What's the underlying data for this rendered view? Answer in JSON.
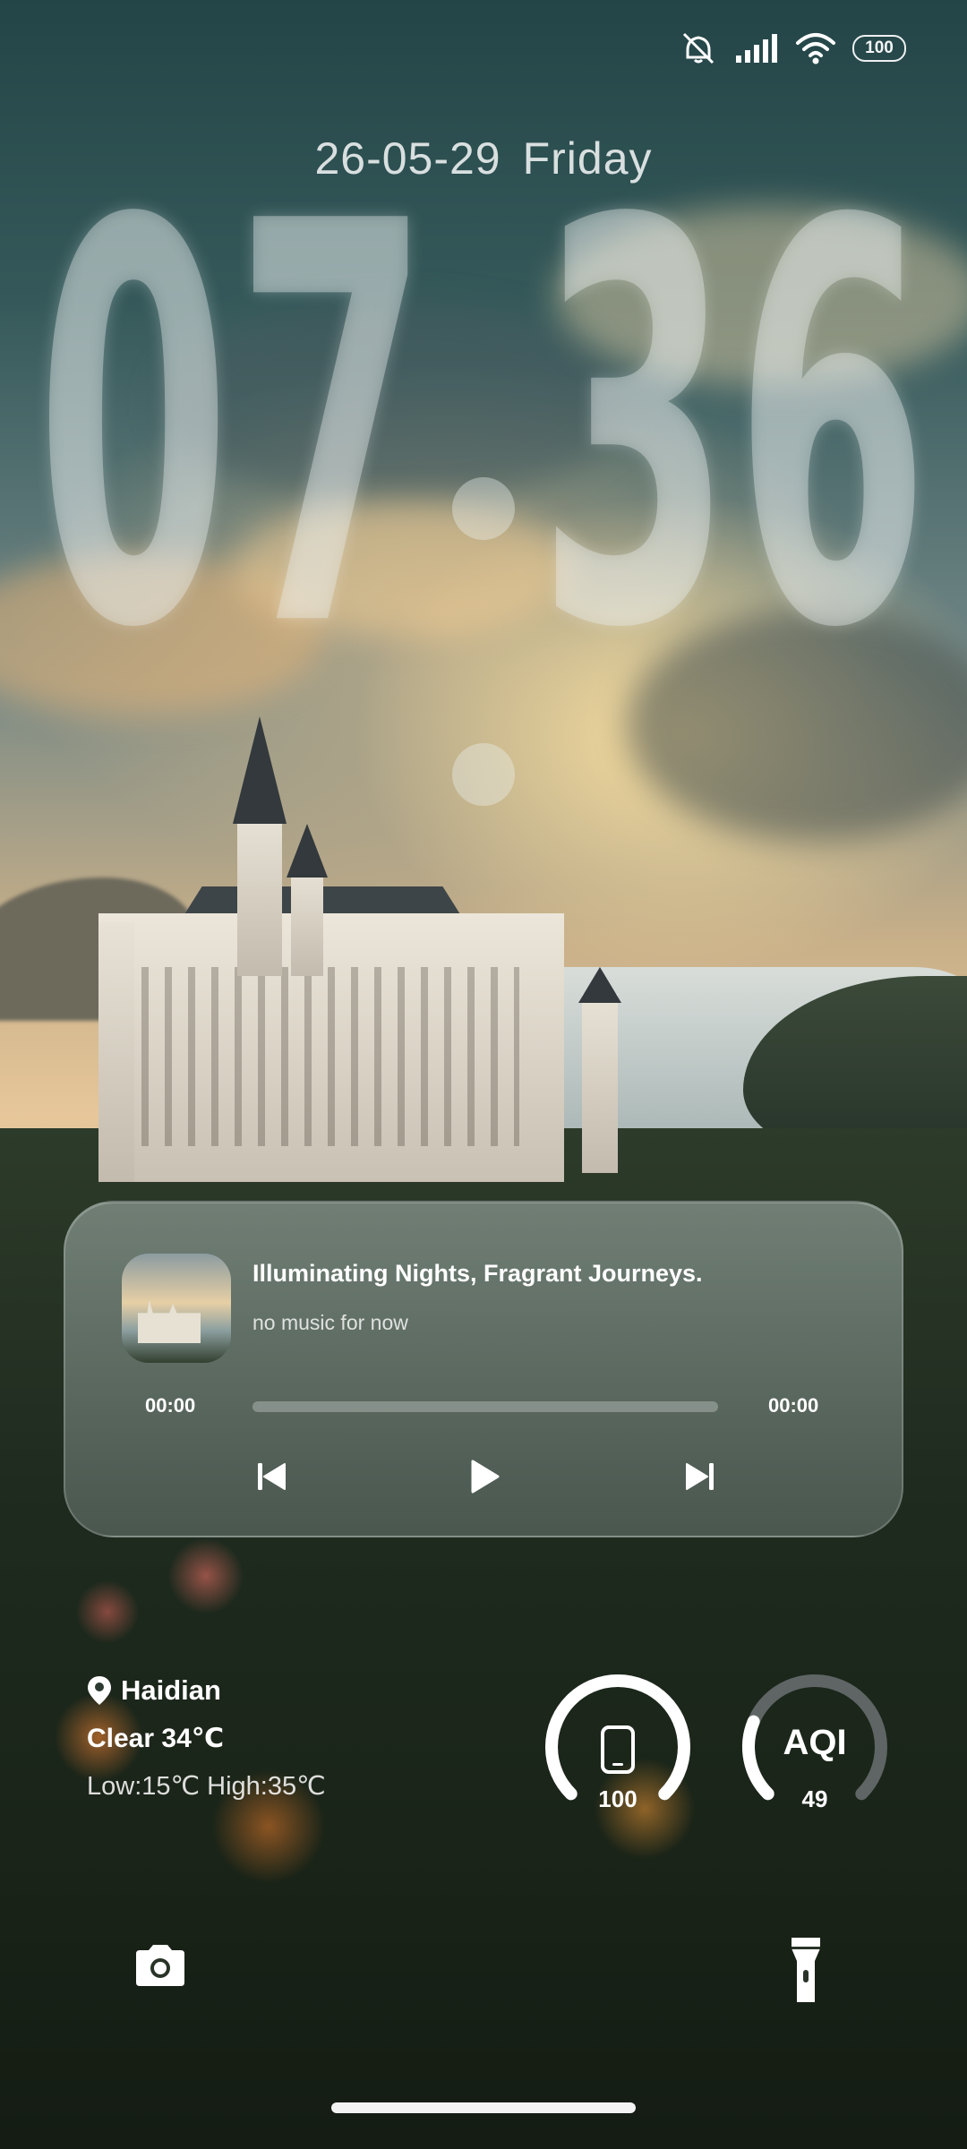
{
  "status_bar": {
    "icons": [
      "mute-icon",
      "signal-icon",
      "wifi-icon"
    ],
    "battery": "100"
  },
  "date": {
    "date": "26-05-29",
    "weekday": "Friday"
  },
  "clock": {
    "digits": [
      "0",
      "7",
      "3",
      "6"
    ]
  },
  "music": {
    "title": "Illuminating Nights, Fragrant Journeys.",
    "subtitle": "no music for now",
    "elapsed": "00:00",
    "total": "00:00",
    "progress": 0
  },
  "weather": {
    "location": "Haidian",
    "condition": "Clear 34℃",
    "range": "Low:15℃ High:35℃"
  },
  "gauges": {
    "battery": {
      "value": "100",
      "level": 1.0
    },
    "aqi": {
      "label": "AQI",
      "value": "49",
      "level": 0.25
    }
  },
  "colors": {
    "accent": "#ffffff",
    "gauge_track": "#5f6565"
  }
}
